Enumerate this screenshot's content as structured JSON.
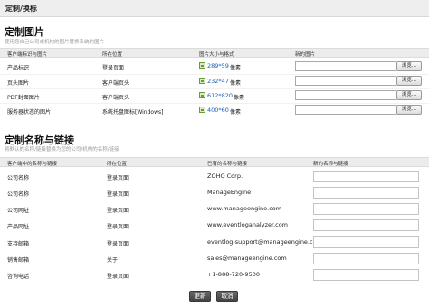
{
  "page": {
    "header": "定制/换标"
  },
  "images_section": {
    "title": "定制图片",
    "description": "使用您自己公司或机构的图片替换系统的图片",
    "columns": [
      "客户端标识与图片",
      "所在位置",
      "图片大小与格式",
      "新的图片"
    ],
    "browse_label": "浏览...",
    "rows": [
      {
        "name": "产品标识",
        "location": "登录页面",
        "dimensions": "289*59",
        "unit": "像素"
      },
      {
        "name": "页头图片",
        "location": "客户端页头",
        "dimensions": "232*47",
        "unit": "像素"
      },
      {
        "name": "PDF封面图片",
        "location": "客户端页头",
        "dimensions": "612*820",
        "unit": "像素"
      },
      {
        "name": "服务器状态的图片",
        "location": "系统托盘图标[Windows]",
        "dimensions": "400*60",
        "unit": "像素"
      }
    ]
  },
  "links_section": {
    "title": "定制名称与链接",
    "description": "将默认的名称/链接替换为您的公司/机构的名称/链接",
    "columns": [
      "客户端中的名称与链接",
      "所在位置",
      "已有的名称与链接",
      "新的名称与链接"
    ],
    "rows": [
      {
        "name": "公司名称",
        "location": "登录页面",
        "current": "ZOHO Corp."
      },
      {
        "name": "公司名称",
        "location": "登录页面",
        "current": "ManageEngine"
      },
      {
        "name": "公司网址",
        "location": "登录页面",
        "current": "www.manageengine.com"
      },
      {
        "name": "产品网址",
        "location": "登录页面",
        "current": "www.eventloganalyzer.com"
      },
      {
        "name": "支持邮箱",
        "location": "登录页面",
        "current": "eventlog-support@manageengine.com"
      },
      {
        "name": "销售邮箱",
        "location": "关于",
        "current": "sales@manageengine.com"
      },
      {
        "name": "咨询电话",
        "location": "登录页面",
        "current": "+1-888-720-9500"
      }
    ]
  },
  "actions": {
    "update_label": "更新",
    "cancel_label": "取消"
  }
}
